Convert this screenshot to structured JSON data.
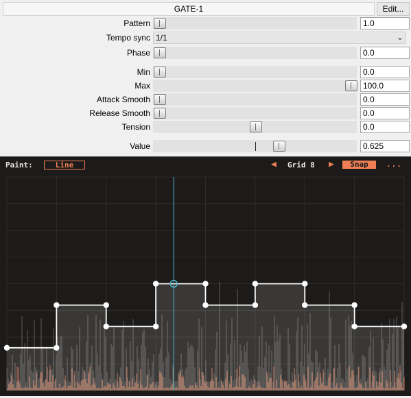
{
  "header": {
    "title": "GATE-1",
    "edit_label": "Edit..."
  },
  "params": {
    "pattern": {
      "label": "Pattern",
      "value": "1.0",
      "slider_fraction": 0.0
    },
    "tempo_sync": {
      "label": "Tempo sync",
      "value": "1/1"
    },
    "phase": {
      "label": "Phase",
      "value": "0.0",
      "slider_fraction": 0.0
    },
    "min": {
      "label": "Min",
      "value": "0.0",
      "slider_fraction": 0.0
    },
    "max": {
      "label": "Max",
      "value": "100.0",
      "slider_fraction": 1.0
    },
    "attack_smooth": {
      "label": "Attack Smooth",
      "value": "0.0",
      "slider_fraction": 0.0
    },
    "release_smooth": {
      "label": "Release Smooth",
      "value": "0.0",
      "slider_fraction": 0.0
    },
    "tension": {
      "label": "Tension",
      "value": "0.0",
      "slider_fraction": 0.5
    },
    "value": {
      "label": "Value",
      "value": "0.625",
      "slider_fraction": 0.625
    }
  },
  "editor": {
    "paint_label": "Paint:",
    "paint_mode": "Line",
    "grid_label": "Grid 8",
    "snap_label": "Snap",
    "more_label": "...",
    "playhead_position": 0.42,
    "envelope_points": [
      [
        0.0,
        0.2
      ],
      [
        0.125,
        0.2
      ],
      [
        0.125,
        0.4
      ],
      [
        0.25,
        0.4
      ],
      [
        0.25,
        0.3
      ],
      [
        0.375,
        0.3
      ],
      [
        0.375,
        0.5
      ],
      [
        0.5,
        0.5
      ],
      [
        0.5,
        0.4
      ],
      [
        0.625,
        0.4
      ],
      [
        0.625,
        0.5
      ],
      [
        0.75,
        0.5
      ],
      [
        0.75,
        0.4
      ],
      [
        0.875,
        0.4
      ],
      [
        0.875,
        0.3
      ],
      [
        1.0,
        0.3
      ]
    ]
  },
  "colors": {
    "accent": "#f07f55",
    "playhead": "#4fb6c8",
    "envelope": "#ffffff"
  },
  "icons": {
    "left_arrow": "left-arrow-icon",
    "right_arrow": "right-arrow-icon",
    "dropdown": "chevron-down-icon"
  }
}
